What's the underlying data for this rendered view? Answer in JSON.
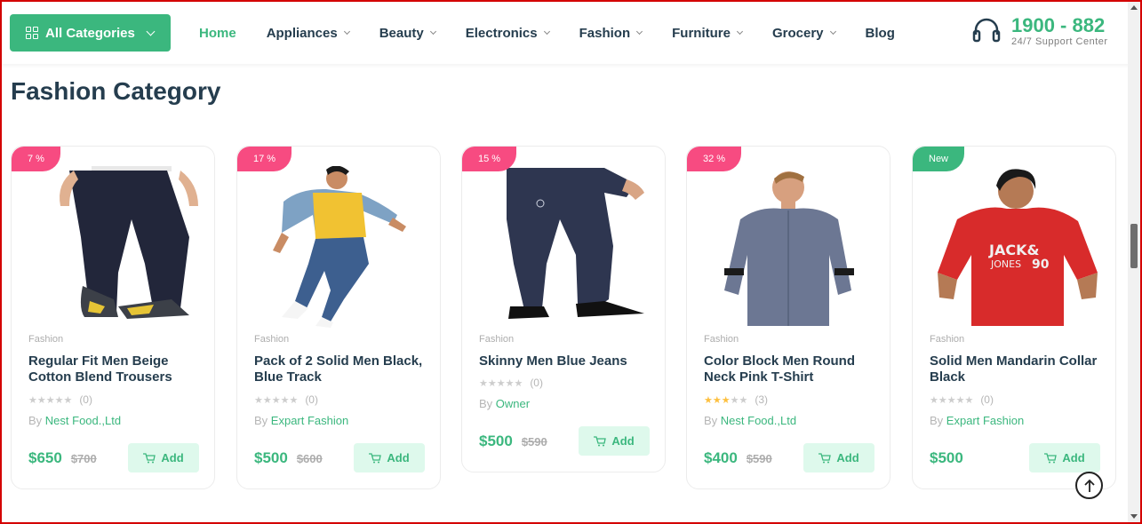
{
  "header": {
    "all_categories": "All Categories",
    "nav": [
      {
        "label": "Home",
        "active": true,
        "dropdown": false
      },
      {
        "label": "Appliances",
        "active": false,
        "dropdown": true
      },
      {
        "label": "Beauty",
        "active": false,
        "dropdown": true
      },
      {
        "label": "Electronics",
        "active": false,
        "dropdown": true
      },
      {
        "label": "Fashion",
        "active": false,
        "dropdown": true
      },
      {
        "label": "Furniture",
        "active": false,
        "dropdown": true
      },
      {
        "label": "Grocery",
        "active": false,
        "dropdown": true
      },
      {
        "label": "Blog",
        "active": false,
        "dropdown": false
      }
    ],
    "support_phone": "1900 - 882",
    "support_sub": "24/7 Support Center"
  },
  "section": {
    "title": "Fashion Category"
  },
  "colors": {
    "brand": "#3bb77e",
    "badge_pink": "#f74b81",
    "text_dark": "#253d4e"
  },
  "products": [
    {
      "badge": "7 %",
      "badge_color": "pink",
      "category": "Fashion",
      "title": "Regular Fit Men Beige Cotton Blend Trousers",
      "rating_stars": 0,
      "rating_count": "(0)",
      "by_prefix": "By",
      "vendor": "Nest Food.,Ltd",
      "price": "$650",
      "old_price": "$700",
      "add_label": "Add"
    },
    {
      "badge": "17 %",
      "badge_color": "pink",
      "category": "Fashion",
      "title": "Pack of 2 Solid Men Black, Blue Track",
      "rating_stars": 0,
      "rating_count": "(0)",
      "by_prefix": "By",
      "vendor": "Expart Fashion",
      "price": "$500",
      "old_price": "$600",
      "add_label": "Add"
    },
    {
      "badge": "15 %",
      "badge_color": "pink",
      "category": "Fashion",
      "title": "Skinny Men Blue Jeans",
      "rating_stars": 0,
      "rating_count": "(0)",
      "by_prefix": "By",
      "vendor": "Owner",
      "price": "$500",
      "old_price": "$590",
      "add_label": "Add"
    },
    {
      "badge": "32 %",
      "badge_color": "pink",
      "category": "Fashion",
      "title": "Color Block Men Round Neck Pink T-Shirt",
      "rating_stars": 3,
      "rating_count": "(3)",
      "by_prefix": "By",
      "vendor": "Nest Food.,Ltd",
      "price": "$400",
      "old_price": "$590",
      "add_label": "Add"
    },
    {
      "badge": "New",
      "badge_color": "green",
      "category": "Fashion",
      "title": "Solid Men Mandarin Collar Black",
      "rating_stars": 0,
      "rating_count": "(0)",
      "by_prefix": "By",
      "vendor": "Expart Fashion",
      "price": "$500",
      "old_price": "",
      "add_label": "Add"
    }
  ]
}
